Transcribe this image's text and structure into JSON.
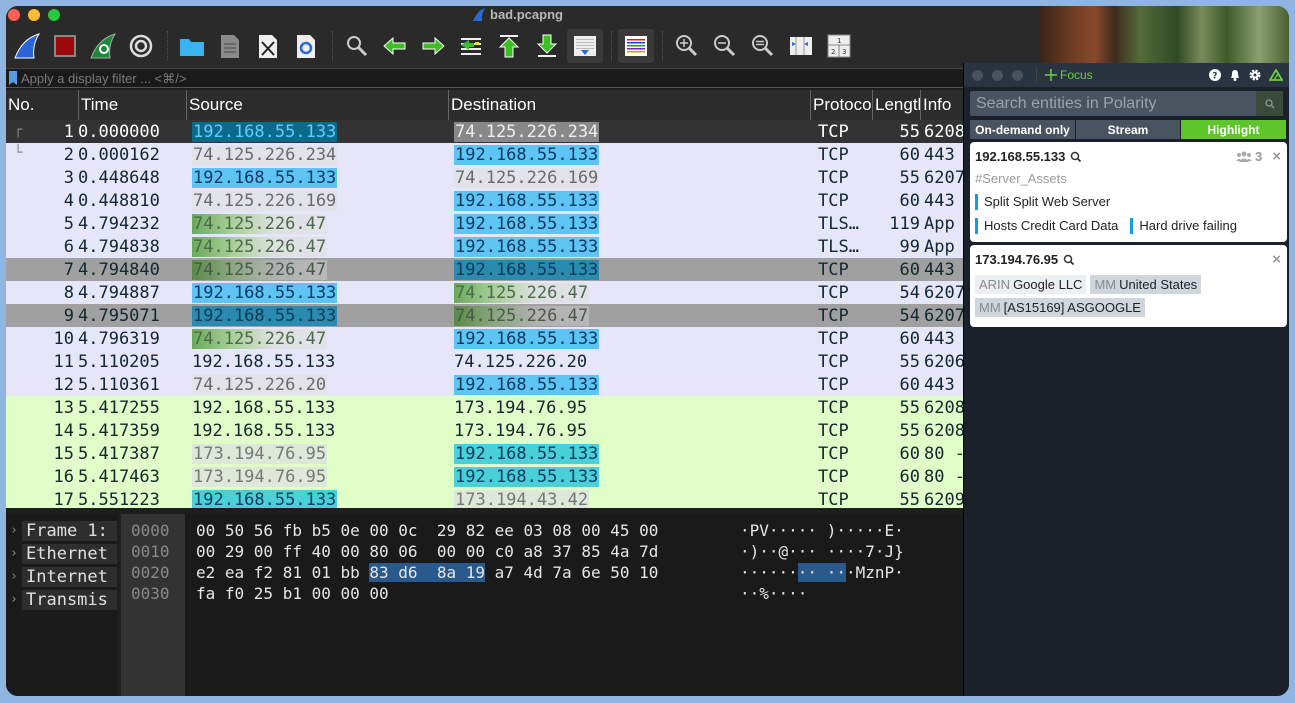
{
  "window": {
    "title": "bad.pcapng"
  },
  "toolbar": {
    "buttons": [
      {
        "name": "start-capture",
        "icon": "shark-fin-icon"
      },
      {
        "name": "stop-capture",
        "icon": "stop-square-icon"
      },
      {
        "name": "restart-capture",
        "icon": "restart-fin-icon"
      },
      {
        "name": "capture-options",
        "icon": "gear-icon"
      },
      {
        "name": "open-file",
        "icon": "folder-icon"
      },
      {
        "name": "save-file",
        "icon": "binary-file-icon"
      },
      {
        "name": "close-file",
        "icon": "close-file-icon"
      },
      {
        "name": "reload-file",
        "icon": "reload-file-icon"
      },
      {
        "name": "find-packet",
        "icon": "magnifier-icon"
      },
      {
        "name": "go-back",
        "icon": "arrow-left-icon"
      },
      {
        "name": "go-forward",
        "icon": "arrow-right-icon"
      },
      {
        "name": "go-to-packet",
        "icon": "jump-to-icon"
      },
      {
        "name": "go-first",
        "icon": "arrow-up-first-icon"
      },
      {
        "name": "go-last",
        "icon": "arrow-down-last-icon"
      },
      {
        "name": "auto-scroll",
        "icon": "autoscroll-icon"
      },
      {
        "name": "colorize",
        "icon": "colorize-lines-icon"
      },
      {
        "name": "zoom-in",
        "icon": "zoom-in-icon"
      },
      {
        "name": "zoom-out",
        "icon": "zoom-out-icon"
      },
      {
        "name": "zoom-normal",
        "icon": "zoom-reset-icon"
      },
      {
        "name": "resize-columns",
        "icon": "resize-columns-icon"
      },
      {
        "name": "layout",
        "icon": "layout-panes-icon"
      }
    ]
  },
  "filter": {
    "placeholder": "Apply a display filter ... <⌘/>"
  },
  "packet_list": {
    "columns": [
      "No.",
      "Time",
      "Source",
      "Destination",
      "Protocol",
      "Length",
      "Info"
    ],
    "rows": [
      {
        "no": "1",
        "time": "0.000000",
        "src": "192.168.55.133",
        "dst": "74.125.226.234",
        "proto": "TCP",
        "len": "55",
        "info": "6208"
      },
      {
        "no": "2",
        "time": "0.000162",
        "src": "74.125.226.234",
        "dst": "192.168.55.133",
        "proto": "TCP",
        "len": "60",
        "info": "443"
      },
      {
        "no": "3",
        "time": "0.448648",
        "src": "192.168.55.133",
        "dst": "74.125.226.169",
        "proto": "TCP",
        "len": "55",
        "info": "6207"
      },
      {
        "no": "4",
        "time": "0.448810",
        "src": "74.125.226.169",
        "dst": "192.168.55.133",
        "proto": "TCP",
        "len": "60",
        "info": "443"
      },
      {
        "no": "5",
        "time": "4.794232",
        "src": "74.125.226.47",
        "dst": "192.168.55.133",
        "proto": "TLS…",
        "len": "119",
        "info": "App"
      },
      {
        "no": "6",
        "time": "4.794838",
        "src": "74.125.226.47",
        "dst": "192.168.55.133",
        "proto": "TLS…",
        "len": "99",
        "info": "App"
      },
      {
        "no": "7",
        "time": "4.794840",
        "src": "74.125.226.47",
        "dst": "192.168.55.133",
        "proto": "TCP",
        "len": "60",
        "info": "443"
      },
      {
        "no": "8",
        "time": "4.794887",
        "src": "192.168.55.133",
        "dst": "74.125.226.47",
        "proto": "TCP",
        "len": "54",
        "info": "6207"
      },
      {
        "no": "9",
        "time": "4.795071",
        "src": "192.168.55.133",
        "dst": "74.125.226.47",
        "proto": "TCP",
        "len": "54",
        "info": "6207"
      },
      {
        "no": "10",
        "time": "4.796319",
        "src": "74.125.226.47",
        "dst": "192.168.55.133",
        "proto": "TCP",
        "len": "60",
        "info": "443"
      },
      {
        "no": "11",
        "time": "5.110205",
        "src": "192.168.55.133",
        "dst": "74.125.226.20",
        "proto": "TCP",
        "len": "55",
        "info": "6206"
      },
      {
        "no": "12",
        "time": "5.110361",
        "src": "74.125.226.20",
        "dst": "192.168.55.133",
        "proto": "TCP",
        "len": "60",
        "info": "443"
      },
      {
        "no": "13",
        "time": "5.417255",
        "src": "192.168.55.133",
        "dst": "173.194.76.95",
        "proto": "TCP",
        "len": "55",
        "info": "6208"
      },
      {
        "no": "14",
        "time": "5.417359",
        "src": "192.168.55.133",
        "dst": "173.194.76.95",
        "proto": "TCP",
        "len": "55",
        "info": "6208"
      },
      {
        "no": "15",
        "time": "5.417387",
        "src": "173.194.76.95",
        "dst": "192.168.55.133",
        "proto": "TCP",
        "len": "60",
        "info": "80 -"
      },
      {
        "no": "16",
        "time": "5.417463",
        "src": "173.194.76.95",
        "dst": "192.168.55.133",
        "proto": "TCP",
        "len": "60",
        "info": "80 -"
      },
      {
        "no": "17",
        "time": "5.551223",
        "src": "192.168.55.133",
        "dst": "173.194.43.42",
        "proto": "TCP",
        "len": "55",
        "info": "6209"
      }
    ]
  },
  "details": {
    "items": [
      "Frame 1:",
      "Ethernet",
      "Internet",
      "Transmis"
    ]
  },
  "hex": {
    "rows": [
      {
        "offset": "0000",
        "pre": "00 50 56 fb b5 0e 00 0c  29 82 ee 03 08 00 45 00",
        "sel": "",
        "post": "",
        "ascii_pre": "·PV····· )·····E·",
        "ascii_sel": "",
        "ascii_post": ""
      },
      {
        "offset": "0010",
        "pre": "00 29 00 ff 40 00 80 06  00 00 c0 a8 37 85 4a 7d",
        "sel": "",
        "post": "",
        "ascii_pre": "·)··@··· ····7·J}",
        "ascii_sel": "",
        "ascii_post": ""
      },
      {
        "offset": "0020",
        "pre": "e2 ea f2 81 01 bb ",
        "sel": "83 d6  8a 19",
        "post": " a7 4d 7a 6e 50 10",
        "ascii_pre": "······",
        "ascii_sel": "·· ··",
        "ascii_post": "·MznP·"
      },
      {
        "offset": "0030",
        "pre": "fa f0 25 b1 00 00 00",
        "sel": "",
        "post": "",
        "ascii_pre": "··%····",
        "ascii_sel": "",
        "ascii_post": ""
      }
    ]
  },
  "polarity": {
    "focus_label": "Focus",
    "search_placeholder": "Search entities in Polarity",
    "tabs": [
      "On-demand only",
      "Stream",
      "Highlight"
    ],
    "active_tab": "Highlight",
    "accent_color": "#5ec62a",
    "cards": [
      {
        "entity": "192.168.55.133",
        "user_count": "3",
        "tag": "#Server_Assets",
        "annotations_line1": [
          "Split Split Web Server"
        ],
        "annotations_line2": [
          "Hosts Credit Card Data",
          "Hard drive failing"
        ]
      },
      {
        "entity": "173.194.76.95",
        "chips": [
          {
            "source": "ARIN",
            "value": "Google LLC"
          },
          {
            "source": "MM",
            "value": "United States"
          },
          {
            "source": "MM",
            "value": "[AS15169] ASGOOGLE"
          }
        ]
      }
    ]
  }
}
